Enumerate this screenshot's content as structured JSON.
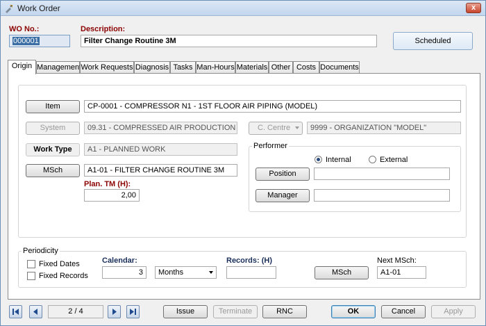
{
  "window": {
    "title": "Work Order",
    "close": "x"
  },
  "header": {
    "wo_label": "WO No.:",
    "wo_value": "000001",
    "desc_label": "Description:",
    "desc_value": "Filter Change Routine 3M",
    "status": "Scheduled"
  },
  "tabs": [
    "Origin",
    "Management",
    "Work Requests",
    "Diagnosis",
    "Tasks",
    "Man-Hours",
    "Materials",
    "Other",
    "Costs",
    "Documents"
  ],
  "origin": {
    "item_button": "Item",
    "item_value": "CP-0001 - COMPRESSOR N1 - 1ST FLOOR AIR PIPING (MODEL)",
    "system_button": "System",
    "system_value": "09.31 - COMPRESSED AIR PRODUCTION",
    "ccentre_button": "C. Centre",
    "ccentre_value": "9999 - ORGANIZATION \"MODEL\"",
    "worktype_label": "Work Type",
    "worktype_value": "A1 - PLANNED WORK",
    "msch_button": "MSch",
    "msch_value": "A1-01 - FILTER CHANGE ROUTINE 3M",
    "plan_tm_label": "Plan. TM (H):",
    "plan_tm_value": "2,00",
    "performer": {
      "label": "Performer",
      "internal": "Internal",
      "external": "External",
      "position_button": "Position",
      "position_value": "",
      "manager_button": "Manager",
      "manager_value": ""
    }
  },
  "periodicity": {
    "label": "Periodicity",
    "fixed_dates": "Fixed Dates",
    "fixed_records": "Fixed Records",
    "calendar_label": "Calendar:",
    "calendar_value": "3",
    "calendar_unit": "Months",
    "records_label": "Records: (H)",
    "records_value": "",
    "msch_button": "MSch",
    "next_msch_label": "Next MSch:",
    "next_msch_value": "A1-01"
  },
  "footer": {
    "counter": "2 / 4",
    "issue": "Issue",
    "terminate": "Terminate",
    "rnc": "RNC",
    "ok": "OK",
    "cancel": "Cancel",
    "apply": "Apply"
  }
}
